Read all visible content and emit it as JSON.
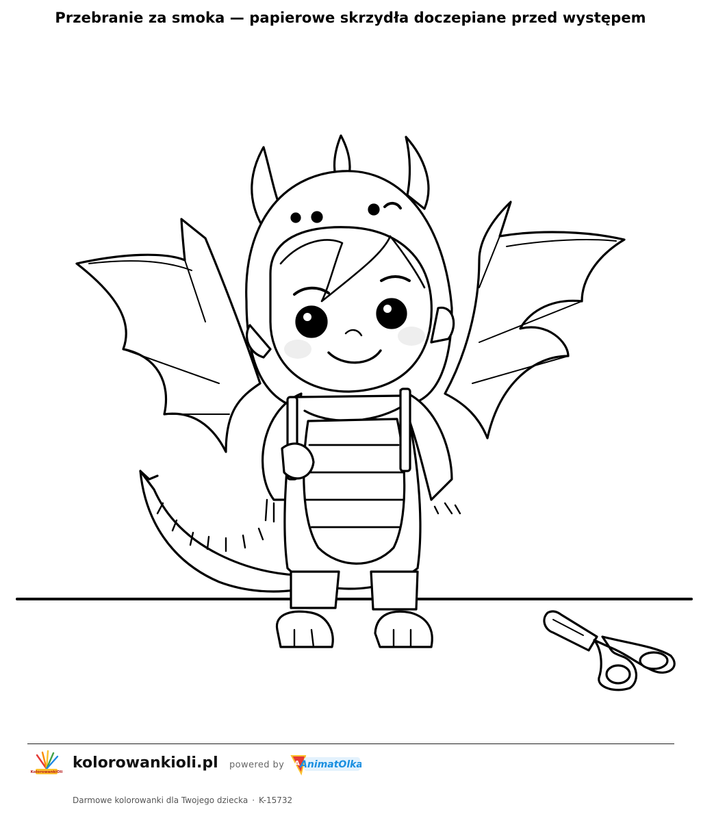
{
  "page": {
    "title": "Przebranie za smoka — papierowe skrzydła doczepiane przed występem"
  },
  "illustration": {
    "subject": "dragon-costume-child",
    "icons": [
      "dragon-costume-drawing",
      "scissors-icon"
    ]
  },
  "footer": {
    "site_name": "kolorowankioli.pl",
    "powered_by": "powered by",
    "brand_text": "AnimatOlka",
    "logo_text": "KolorowankiOli",
    "tagline": "Darmowe kolorowanki dla Twojego dziecka",
    "separator": "·",
    "code": "K-15732",
    "colors": {
      "brand_blue": "#1a8fe0",
      "brand_red": "#e53935",
      "brand_yellow": "#fbc02d"
    }
  }
}
